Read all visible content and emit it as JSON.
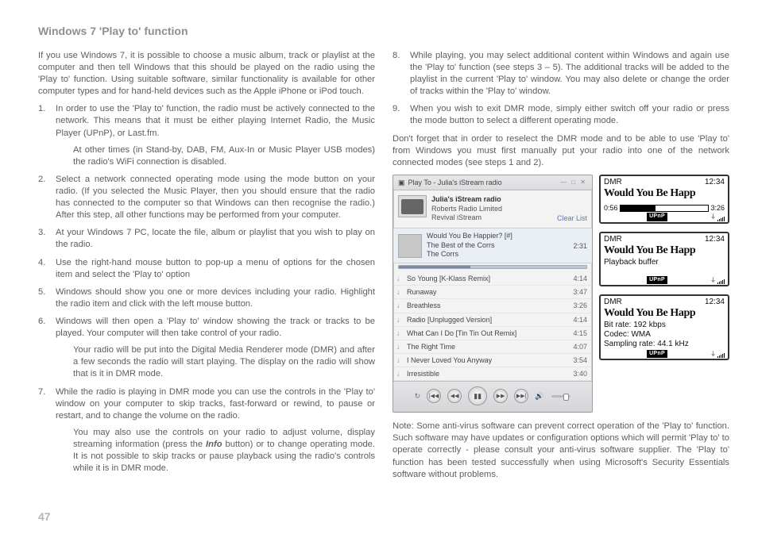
{
  "heading": "Windows 7 'Play to' function",
  "intro": "If you use Windows 7, it is possible to choose a music album, track or playlist at the computer and then tell Windows that this should be played on the radio using the 'Play to' function. Using suitable software, similar functionality is available for other computer types and for hand-held devices such as the Apple iPhone or iPod touch.",
  "steps_a": [
    "In order to use the 'Play to' function, the radio must be actively connected to the network. This means that it must be either playing Internet Radio, the Music Player (UPnP), or Last.fm.",
    "Select a network connected operating mode using the mode button on your radio. (If you selected the Music Player, then you should ensure that the radio has connected to the computer so that Windows can then recognise the radio.) After this step, all other functions may be performed from your computer.",
    "At your Windows 7 PC, locate the file, album or playlist that you wish to play on the radio.",
    "Use the right-hand mouse button to pop-up a menu of options for the chosen item and select the 'Play to' option",
    "Windows should show you one or more devices including your radio. Highlight the radio item and click with the left mouse button.",
    "Windows will then open a 'Play to' window showing the track or tracks to be played. Your computer will then take control of your radio.",
    "While the radio is playing in DMR mode you can use the controls in the 'Play to' window on your computer to skip tracks, fast-forward or rewind, to pause or restart, and to change the volume on the radio."
  ],
  "step1_extra": "At other times (in Stand-by, DAB, FM, Aux-In or Music Player USB modes) the radio's WiFi connection is disabled.",
  "step6_extra": "Your radio will be put into the Digital Media Renderer mode (DMR) and after a few seconds the radio will start playing. The display on the radio will show that is it in DMR mode.",
  "step7_extra": "You may also use the controls on your radio to adjust volume, display streaming information (press the Info button) or to change operating mode. It is not possible to skip tracks or pause playback using the radio's controls while it is in DMR mode.",
  "steps_b": [
    "While playing, you may select additional content within Windows and again use the 'Play to' function (see steps 3 – 5). The additional tracks will be added to the playlist in the current 'Play to' window. You may also delete or change the order of tracks within the 'Play to' window.",
    "When you wish to exit DMR mode, simply either switch off your radio or press the mode button to select a different operating mode."
  ],
  "dont_forget": "Don't forget that in order to reselect the DMR mode and to be able to use 'Play to' from Windows you must first manually put your radio into one of the network connected modes (see steps 1 and 2).",
  "note": "Note: Some anti-virus software can prevent correct operation of the 'Play to' function. Such software may have updates or configuration options which will permit 'Play to' to operate correctly - please consult your anti-virus software supplier. The 'Play to' function has been tested successfully when using Microsoft's Security Essentials software without problems.",
  "page_num": "47",
  "playto_window": {
    "title": "Play To - Julia's iStream radio",
    "device_name": "Julia's iStream radio",
    "device_maker": "Roberts Radio Limited",
    "device_model": "Revival iStream",
    "clear_list": "Clear List",
    "np_title": "Would You Be Happier? [#]",
    "np_album": "The Best of the Corrs",
    "np_artist": "The Corrs",
    "np_dur": "2:31",
    "tracks": [
      {
        "t": "So Young [K-Klass Remix]",
        "d": "4:14"
      },
      {
        "t": "Runaway",
        "d": "3:47"
      },
      {
        "t": "Breathless",
        "d": "3:26"
      },
      {
        "t": "Radio [Unplugged Version]",
        "d": "4:14"
      },
      {
        "t": "What Can I Do [Tin Tin Out Remix]",
        "d": "4:15"
      },
      {
        "t": "The Right Time",
        "d": "4:07"
      },
      {
        "t": "I Never Loved You Anyway",
        "d": "3:54"
      },
      {
        "t": "Irresistible",
        "d": "3:40"
      }
    ]
  },
  "lcd_common": {
    "mode": "DMR",
    "time": "12:34",
    "title": "Would You Be Happ",
    "upnp": "UPnP"
  },
  "lcd1": {
    "elapsed": "0:56",
    "total": "3:26"
  },
  "lcd2": {
    "sub": "Playback buffer"
  },
  "lcd3": {
    "l1": "Bit rate: 192 kbps",
    "l2": "Codec: WMA",
    "l3": "Sampling rate: 44.1 kHz"
  }
}
